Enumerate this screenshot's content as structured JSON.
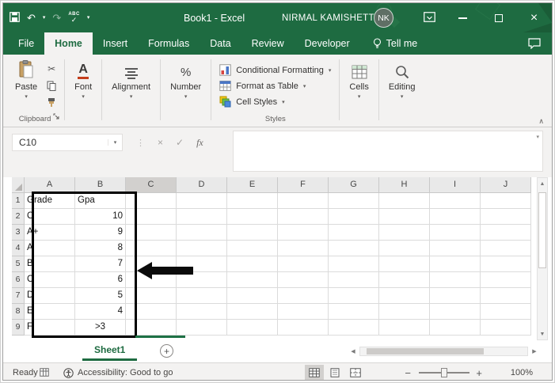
{
  "titlebar": {
    "title": "Book1 - Excel",
    "user": "NIRMAL KAMISHETTY",
    "initials": "NK"
  },
  "tabs": [
    {
      "label": "File"
    },
    {
      "label": "Home",
      "active": true
    },
    {
      "label": "Insert"
    },
    {
      "label": "Formulas"
    },
    {
      "label": "Data"
    },
    {
      "label": "Review"
    },
    {
      "label": "Developer"
    }
  ],
  "tell_me": "Tell me",
  "ribbon": {
    "paste": "Paste",
    "clipboard_label": "Clipboard",
    "font_label": "Font",
    "alignment_label": "Alignment",
    "number_label": "Number",
    "styles": {
      "items": [
        "Conditional Formatting",
        "Format as Table",
        "Cell Styles"
      ],
      "label": "Styles"
    },
    "cells_label": "Cells",
    "editing_label": "Editing"
  },
  "formula_bar": {
    "name_box": "C10",
    "fx": "fx",
    "value": ""
  },
  "grid": {
    "columns": [
      "A",
      "B",
      "C",
      "D",
      "E",
      "F",
      "G",
      "H",
      "I",
      "J"
    ],
    "selected_column": "C",
    "active_cell": "C10",
    "rows": [
      {
        "n": "1",
        "cells": [
          {
            "v": "Grade",
            "a": "left"
          },
          {
            "v": "Gpa",
            "a": "left"
          }
        ]
      },
      {
        "n": "2",
        "cells": [
          {
            "v": "O",
            "a": "left"
          },
          {
            "v": "10",
            "a": "right"
          }
        ]
      },
      {
        "n": "3",
        "cells": [
          {
            "v": "A+",
            "a": "left"
          },
          {
            "v": "9",
            "a": "right"
          }
        ]
      },
      {
        "n": "4",
        "cells": [
          {
            "v": "A",
            "a": "left"
          },
          {
            "v": "8",
            "a": "right"
          }
        ]
      },
      {
        "n": "5",
        "cells": [
          {
            "v": "B",
            "a": "left"
          },
          {
            "v": "7",
            "a": "right"
          }
        ]
      },
      {
        "n": "6",
        "cells": [
          {
            "v": "C",
            "a": "left"
          },
          {
            "v": "6",
            "a": "right"
          }
        ]
      },
      {
        "n": "7",
        "cells": [
          {
            "v": "D",
            "a": "left"
          },
          {
            "v": "5",
            "a": "right"
          }
        ]
      },
      {
        "n": "8",
        "cells": [
          {
            "v": "E",
            "a": "left"
          },
          {
            "v": "4",
            "a": "right"
          }
        ]
      },
      {
        "n": "9",
        "cells": [
          {
            "v": "F",
            "a": "left"
          },
          {
            "v": ">3",
            "a": "center"
          }
        ]
      }
    ]
  },
  "sheet_bar": {
    "sheet": "Sheet1",
    "add": "+"
  },
  "status_bar": {
    "mode": "Ready",
    "accessibility": "Accessibility: Good to go",
    "zoom_out": "−",
    "zoom_in": "+",
    "zoom": "100%"
  },
  "icons": {
    "undo": "↶",
    "redo": "↷",
    "dropdown": "▾",
    "cut": "✂",
    "dots": "⋮",
    "cancel": "×",
    "enter": "✓",
    "collapse": "∧",
    "up": "▲",
    "down": "▼",
    "left": "◀",
    "right": "▶",
    "close": "×",
    "spell_abc": "ABC",
    "spell_check": "✓",
    "percent": "%",
    "font_a": "A"
  }
}
